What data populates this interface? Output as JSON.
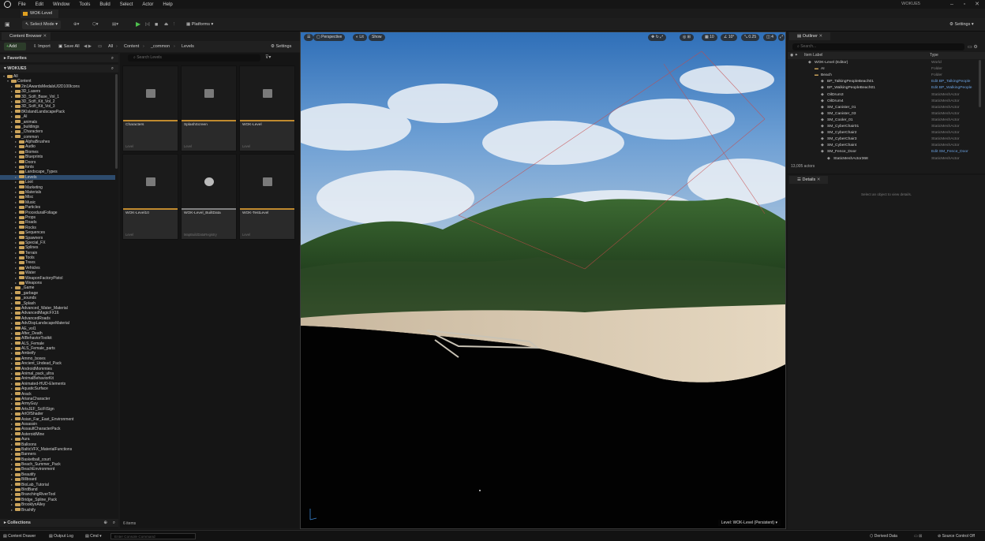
{
  "menu": {
    "items": [
      "File",
      "Edit",
      "Window",
      "Tools",
      "Build",
      "Select",
      "Actor",
      "Help"
    ],
    "app_name": "WOKUE5"
  },
  "level_tab": "WOK-Level",
  "toolbar": {
    "select_mode": "Select Mode",
    "platforms": "Platforms",
    "settings": "Settings"
  },
  "content_browser": {
    "tab": "Content Browser",
    "add": "Add",
    "import": "Import",
    "save_all": "Save All",
    "breadcrumb": [
      "All",
      "Content",
      "_common",
      "Levels"
    ],
    "settings": "Settings",
    "favorites": "Favorites",
    "project": "WOKUE5",
    "collections": "Collections",
    "search_placeholder": "Search Levels",
    "item_count": "6 items",
    "tree": [
      {
        "label": "All",
        "depth": 0
      },
      {
        "label": "Content",
        "depth": 1
      },
      {
        "label": "2in1AwardsMedalsUI2D100Icons",
        "depth": 2
      },
      {
        "label": "3D_Lasers",
        "depth": 2
      },
      {
        "label": "3D_Scifi_Base_Vol_1",
        "depth": 2
      },
      {
        "label": "3D_Scifi_Kit_Vol_2",
        "depth": 2
      },
      {
        "label": "3D_Scifi_Kit_Vol_3",
        "depth": 2
      },
      {
        "label": "8KIslandLandscapePack",
        "depth": 2
      },
      {
        "label": "_AI",
        "depth": 2
      },
      {
        "label": "_animals",
        "depth": 2
      },
      {
        "label": "_buildings",
        "depth": 2
      },
      {
        "label": "_Characters",
        "depth": 2
      },
      {
        "label": "_common",
        "depth": 2
      },
      {
        "label": "AlphaBrushes",
        "depth": 3
      },
      {
        "label": "Audio",
        "depth": 3
      },
      {
        "label": "Biomes",
        "depth": 3
      },
      {
        "label": "Blueprints",
        "depth": 3
      },
      {
        "label": "Doors",
        "depth": 3
      },
      {
        "label": "fonts",
        "depth": 3
      },
      {
        "label": "Landscape_Types",
        "depth": 3
      },
      {
        "label": "Levels",
        "depth": 3,
        "selected": true
      },
      {
        "label": "Loot",
        "depth": 3
      },
      {
        "label": "Marketing",
        "depth": 3
      },
      {
        "label": "Materials",
        "depth": 3
      },
      {
        "label": "Misc",
        "depth": 3
      },
      {
        "label": "Music",
        "depth": 3
      },
      {
        "label": "Particles",
        "depth": 3
      },
      {
        "label": "ProceduralFoliage",
        "depth": 3
      },
      {
        "label": "Props",
        "depth": 3
      },
      {
        "label": "Roads",
        "depth": 3
      },
      {
        "label": "Rocks",
        "depth": 3
      },
      {
        "label": "Sequences",
        "depth": 3
      },
      {
        "label": "Spawners",
        "depth": 3
      },
      {
        "label": "Special_FX",
        "depth": 3
      },
      {
        "label": "Splines",
        "depth": 3
      },
      {
        "label": "Terrain",
        "depth": 3
      },
      {
        "label": "Tools",
        "depth": 3
      },
      {
        "label": "Trees",
        "depth": 3
      },
      {
        "label": "Vehicles",
        "depth": 3
      },
      {
        "label": "Water",
        "depth": 3
      },
      {
        "label": "WeaponFactoryPistol",
        "depth": 3
      },
      {
        "label": "Weapons",
        "depth": 3
      },
      {
        "label": "_Game",
        "depth": 2
      },
      {
        "label": "_garbage",
        "depth": 2
      },
      {
        "label": "_sounds",
        "depth": 2
      },
      {
        "label": "_Splash",
        "depth": 2
      },
      {
        "label": "Advanced_Water_Material",
        "depth": 2
      },
      {
        "label": "AdvancedMagicFX16",
        "depth": 2
      },
      {
        "label": "AdvancedRoads",
        "depth": 2
      },
      {
        "label": "AdvDispLandscapeMaterial",
        "depth": 2
      },
      {
        "label": "AE_vol1",
        "depth": 2
      },
      {
        "label": "After_Death",
        "depth": 2
      },
      {
        "label": "AIBehaviorToolkit",
        "depth": 2
      },
      {
        "label": "ALS_Female",
        "depth": 2
      },
      {
        "label": "ALS_Female_parts",
        "depth": 2
      },
      {
        "label": "Ambeify",
        "depth": 2
      },
      {
        "label": "Ammo_boxes",
        "depth": 2
      },
      {
        "label": "Ancient_Undead_Pack",
        "depth": 2
      },
      {
        "label": "AndroidMommies",
        "depth": 2
      },
      {
        "label": "Animal_pack_ultra",
        "depth": 2
      },
      {
        "label": "AnimalBehaviorKit",
        "depth": 2
      },
      {
        "label": "Animated-HUD-Elements",
        "depth": 2
      },
      {
        "label": "AquaticSurface",
        "depth": 2
      },
      {
        "label": "Arack",
        "depth": 2
      },
      {
        "label": "ArianaCharacter",
        "depth": 2
      },
      {
        "label": "ArmyGuy",
        "depth": 2
      },
      {
        "label": "ArtsJEF_SciFiSign",
        "depth": 2
      },
      {
        "label": "ArtOfShader",
        "depth": 2
      },
      {
        "label": "Asian_Far_East_Environment",
        "depth": 2
      },
      {
        "label": "Assassin",
        "depth": 2
      },
      {
        "label": "AssaultCharacterPack",
        "depth": 2
      },
      {
        "label": "AsteroidMine",
        "depth": 2
      },
      {
        "label": "Aura",
        "depth": 2
      },
      {
        "label": "Balloons",
        "depth": 2
      },
      {
        "label": "BalticVFX_MaterialFunctions",
        "depth": 2
      },
      {
        "label": "Banners",
        "depth": 2
      },
      {
        "label": "Basketball_court",
        "depth": 2
      },
      {
        "label": "Beach_Summer_Pack",
        "depth": 2
      },
      {
        "label": "BeachEnvironment",
        "depth": 2
      },
      {
        "label": "Beautify",
        "depth": 2
      },
      {
        "label": "Billboard",
        "depth": 2
      },
      {
        "label": "BioLab_Tutorial",
        "depth": 2
      },
      {
        "label": "BirdBand",
        "depth": 2
      },
      {
        "label": "BranchingRiverTool",
        "depth": 2
      },
      {
        "label": "Bridge_Spline_Pack",
        "depth": 2
      },
      {
        "label": "BrooklynAlley",
        "depth": 2
      },
      {
        "label": "Brushify",
        "depth": 2
      }
    ],
    "tiles": [
      {
        "name": "Characters",
        "type": "Level"
      },
      {
        "name": "SplashScreen",
        "type": "Level"
      },
      {
        "name": "WOK-Level",
        "type": "Level"
      },
      {
        "name": "WOK-Level10",
        "type": "Level"
      },
      {
        "name": "WOK-Level_BuiltData",
        "type": "MapBuildDataRegistry"
      },
      {
        "name": "WOK-TestLevel",
        "type": "Level"
      }
    ]
  },
  "viewport": {
    "perspective": "Perspective",
    "lit": "Lit",
    "show": "Show",
    "grid_snap": "10",
    "rot_snap": "10°",
    "scale_snap": "0.25",
    "camera_speed": "4",
    "level_label": "Level: WOK-Level (Persistent)"
  },
  "outliner": {
    "tab": "Outliner",
    "search_placeholder": "Search...",
    "col_label": "Item Label",
    "col_type": "Type",
    "rows": [
      {
        "label": "WOK-Level (Editor)",
        "type": "World",
        "indent": 0
      },
      {
        "label": "AI",
        "type": "Folder",
        "indent": 1
      },
      {
        "label": "Beach",
        "type": "Folder",
        "indent": 1
      },
      {
        "label": "BP_TalkingPeopleBeach01",
        "type": "Edit BP_TalkingPeople",
        "indent": 2,
        "edit": true
      },
      {
        "label": "BP_WalkingPeopleBeach01",
        "type": "Edit BP_WalkingPeople",
        "indent": 2,
        "edit": true
      },
      {
        "label": "OilDrum3",
        "type": "StaticMeshActor",
        "indent": 2
      },
      {
        "label": "OilDrum4",
        "type": "StaticMeshActor",
        "indent": 2
      },
      {
        "label": "SM_Canister_01",
        "type": "StaticMeshActor",
        "indent": 2
      },
      {
        "label": "SM_Canister_03",
        "type": "StaticMeshActor",
        "indent": 2
      },
      {
        "label": "SM_Cooler_01",
        "type": "StaticMeshActor",
        "indent": 2
      },
      {
        "label": "SM_CyberChair01",
        "type": "StaticMeshActor",
        "indent": 2
      },
      {
        "label": "SM_CyberChair2",
        "type": "StaticMeshActor",
        "indent": 2
      },
      {
        "label": "SM_CyberChair3",
        "type": "StaticMeshActor",
        "indent": 2
      },
      {
        "label": "SM_CyberChair4",
        "type": "StaticMeshActor",
        "indent": 2
      },
      {
        "label": "SM_Fence_Door",
        "type": "Edit SM_Fence_Door",
        "indent": 2,
        "edit": true
      },
      {
        "label": "StaticMeshActor368",
        "type": "StaticMeshActor",
        "indent": 3
      }
    ],
    "actor_count": "13,005 actors"
  },
  "details": {
    "tab": "Details",
    "empty_hint": "Select an object to view details."
  },
  "statusbar": {
    "content_drawer": "Content Drawer",
    "output_log": "Output Log",
    "cmd": "Cmd",
    "console_placeholder": "Enter Console Command",
    "derived_data": "Derived Data",
    "source_control": "Source Control Off"
  }
}
